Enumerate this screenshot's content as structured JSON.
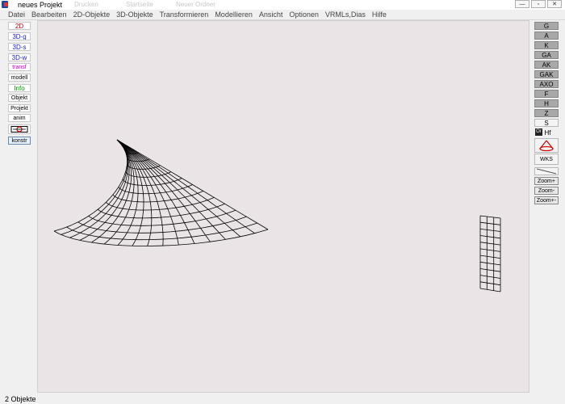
{
  "window": {
    "title": "neues Projekt",
    "ghost_labels": [
      "Drucken",
      "Startseite",
      "Neuer Ordner"
    ],
    "buttons": {
      "minimize": "—",
      "restore": "▫",
      "close": "✕"
    }
  },
  "menu": [
    "Datei",
    "Bearbeiten",
    "2D-Objekte",
    "3D-Objekte",
    "Transformieren",
    "Modellieren",
    "Ansicht",
    "Optionen",
    "VRMLs,Dias",
    "Hilfe"
  ],
  "left_tools": [
    {
      "label": "2D",
      "color": "#cc0000"
    },
    {
      "label": "3D-g",
      "color": "#1a1acc"
    },
    {
      "label": "3D-s",
      "color": "#1a1acc"
    },
    {
      "label": "3D-w",
      "color": "#1a1acc"
    },
    {
      "label": "transf",
      "color": "#cc00cc"
    },
    {
      "label": "modell",
      "color": "#000000"
    },
    {
      "label": "Info",
      "color": "#009900"
    },
    {
      "label": "Objekt",
      "color": "#000000"
    },
    {
      "label": "Projekt",
      "color": "#000000"
    },
    {
      "label": "anim",
      "color": "#000000"
    },
    {
      "label": "konstr",
      "color": "#000000"
    }
  ],
  "right_tools": {
    "views": [
      "G",
      "A",
      "K",
      "GA",
      "AK",
      "GAK",
      "AXO",
      "F",
      "H",
      "Z",
      "S"
    ],
    "hf": "Hf",
    "wks": "WKS",
    "zoom": [
      "Zoom+",
      "Zoom-",
      "Zoom+-"
    ]
  },
  "status": "2 Objekte"
}
